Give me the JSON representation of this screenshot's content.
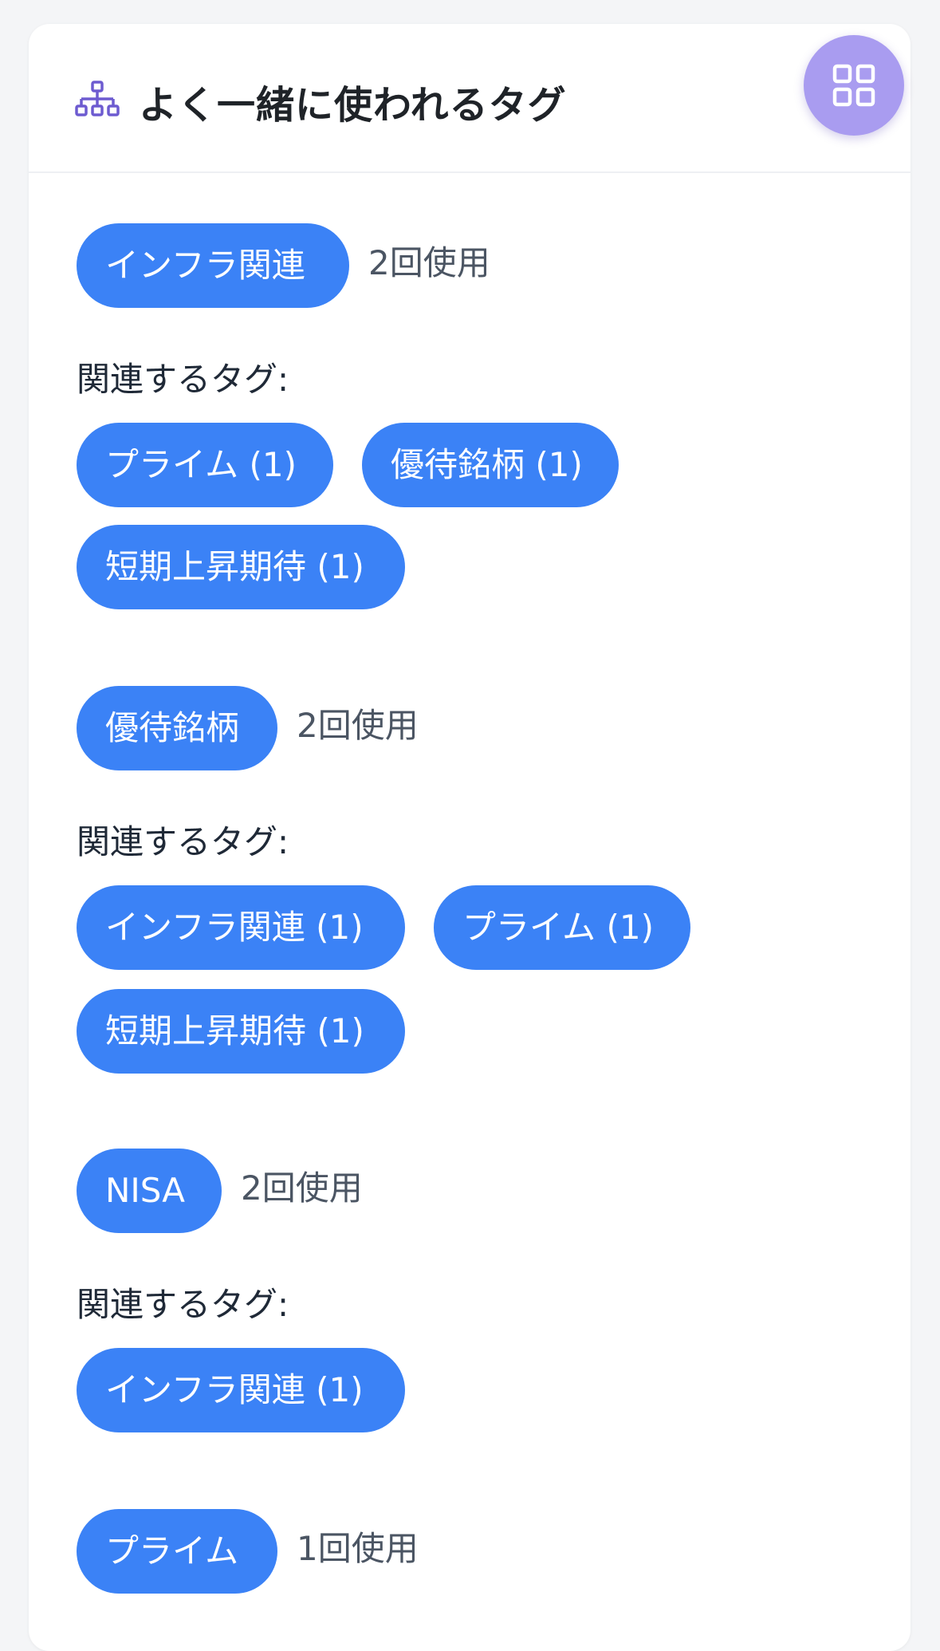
{
  "header": {
    "title": "よく一緒に使われるタグ",
    "icon": "sitemap-icon",
    "fab_icon": "grid-icon"
  },
  "colors": {
    "accent": "#3b82f6",
    "header_icon": "#6d5bd0",
    "fab": "#a99cf0"
  },
  "groups": [
    {
      "tag": "インフラ関連",
      "usage": "2回使用",
      "related_label": "関連するタグ:",
      "related": [
        "プライム (1)",
        "優待銘柄 (1)",
        "短期上昇期待 (1)"
      ]
    },
    {
      "tag": "優待銘柄",
      "usage": "2回使用",
      "related_label": "関連するタグ:",
      "related": [
        "インフラ関連 (1)",
        "プライム (1)",
        "短期上昇期待 (1)"
      ]
    },
    {
      "tag": "NISA",
      "usage": "2回使用",
      "related_label": "関連するタグ:",
      "related": [
        "インフラ関連 (1)"
      ]
    },
    {
      "tag": "プライム",
      "usage": "1回使用"
    }
  ]
}
